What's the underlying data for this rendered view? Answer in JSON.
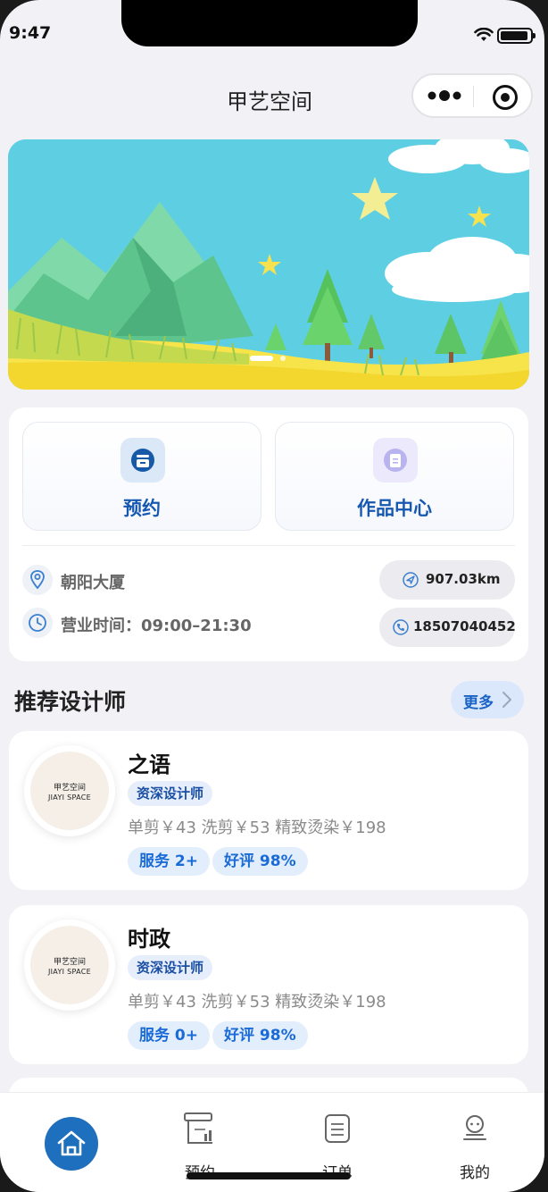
{
  "status_bar": {
    "time": "9:47"
  },
  "nav": {
    "title": "甲艺空间"
  },
  "banner": {
    "slides": 2,
    "active_slide": 1
  },
  "actions": [
    {
      "label": "预约",
      "icon": "calendar-booking-icon",
      "accent": "#1659a8"
    },
    {
      "label": "作品中心",
      "icon": "document-icon",
      "accent": "#a9a3e8"
    }
  ],
  "shop": {
    "address": "朝阳大厦",
    "hours": "营业时间：09:00–21:30",
    "distance": "907.03km",
    "phone": "18507040452"
  },
  "designers_section": {
    "title": "推荐设计师",
    "more_label": "更多"
  },
  "designers": [
    {
      "name": "之语",
      "title": "资深设计师",
      "prices": "单剪￥43 洗剪￥53 精致烫染￥198",
      "services": "服务 2+",
      "rating": "好评 98%",
      "logo_cn": "甲艺空间",
      "logo_en": "JIAYI SPACE"
    },
    {
      "name": "时政",
      "title": "资深设计师",
      "prices": "单剪￥43 洗剪￥53 精致烫染￥198",
      "services": "服务 0+",
      "rating": "好评 98%",
      "logo_cn": "甲艺空间",
      "logo_en": "JIAYI SPACE"
    }
  ],
  "tabbar": {
    "items": [
      {
        "label": "",
        "icon": "home-icon"
      },
      {
        "label": "预约",
        "icon": "booking-chart-icon"
      },
      {
        "label": "订单",
        "icon": "order-list-icon"
      },
      {
        "label": "我的",
        "icon": "profile-icon"
      }
    ],
    "active_index": 0,
    "active_color": "#1f6fbf"
  }
}
